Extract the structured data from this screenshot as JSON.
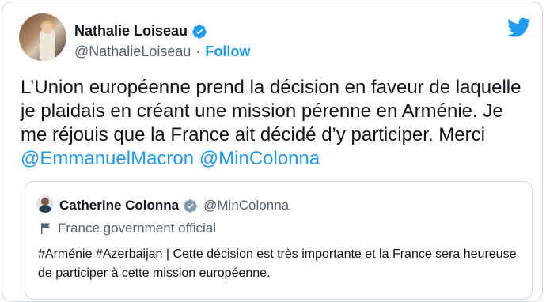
{
  "author": {
    "name": "Nathalie Loiseau",
    "handle": "@NathalieLoiseau",
    "separator": "·",
    "follow_label": "Follow",
    "verified": true
  },
  "tweet": {
    "text_before": "L’Union européenne prend la décision en faveur de laquelle je plaidais en créant une mission pérenne en Arménie. Je me réjouis que la France ait décidé d’y participer. Merci ",
    "mention_1": "@EmmanuelMacron",
    "mention_2": "@MinColonna"
  },
  "quoted_tweet": {
    "name": "Catherine Colonna",
    "handle": "@MinColonna",
    "label": "France government official",
    "text": "#Arménie #Azerbaijan | Cette décision est très importante et la France sera heureuse de participer à cette mission européenne.",
    "verified": true
  },
  "icons": {
    "brand": "twitter-bird-icon",
    "verified": "verified-badge-icon",
    "label": "flag-icon"
  },
  "colors": {
    "accent": "#1d9bf0",
    "text": "#0f1419",
    "secondary": "#536471",
    "border": "#cfd9de"
  }
}
